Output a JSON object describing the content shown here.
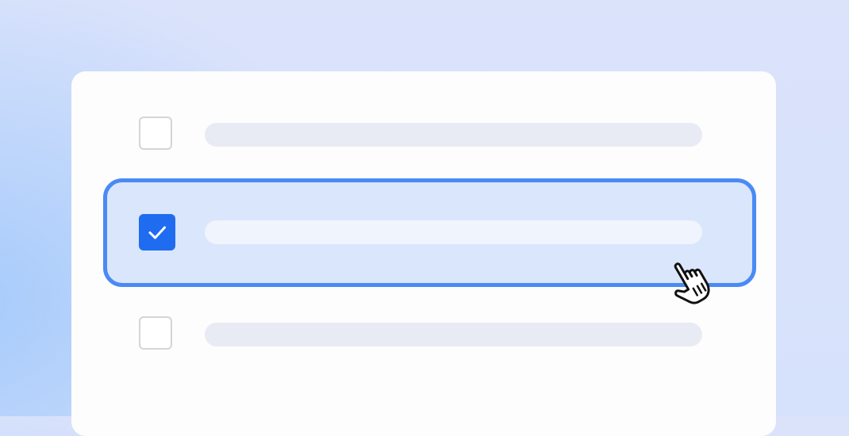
{
  "list": {
    "items": [
      {
        "checked": false,
        "text": ""
      },
      {
        "checked": true,
        "text": "",
        "selected": true
      },
      {
        "checked": false,
        "text": ""
      }
    ]
  },
  "colors": {
    "accent": "#1f6cf0",
    "selection_border": "#4a8af4",
    "selection_fill": "#dae6fc",
    "placeholder_bar": "#e8ebf3",
    "card": "#fdfdfe"
  },
  "icons": {
    "check": "check-icon",
    "cursor": "hand-pointer-cursor-icon"
  }
}
